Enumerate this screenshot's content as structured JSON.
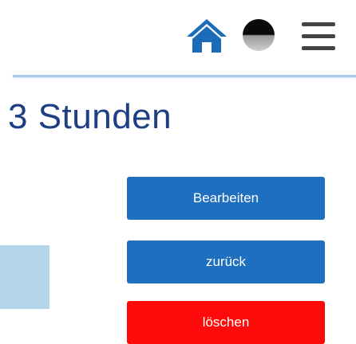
{
  "header": {
    "icons": [
      "home-icon",
      "avatar",
      "menu-icon"
    ],
    "home_color": "#1a6bb8"
  },
  "main": {
    "title": "3 Stunden"
  },
  "actions": {
    "edit_label": "Bearbeiten",
    "back_label": "zurück",
    "delete_label": "löschen",
    "primary_color": "#1e6fbf",
    "danger_color": "#ff0a0a"
  }
}
